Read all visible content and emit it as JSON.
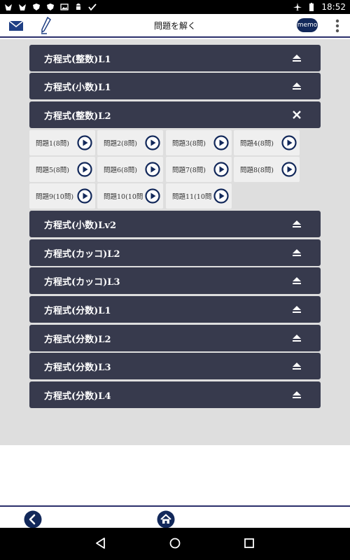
{
  "status_bar": {
    "time": "18:52",
    "left_icons": [
      "app-icon",
      "app-icon",
      "shield-icon",
      "shield-icon",
      "image-icon",
      "android-icon",
      "check-icon"
    ],
    "right_icons": [
      "airplane-icon",
      "battery-icon"
    ]
  },
  "app_bar": {
    "title": "問題を解く",
    "memo_label": "memo",
    "icons": [
      "mail-icon",
      "pen-icon",
      "overflow-menu-icon"
    ]
  },
  "sections_top": [
    {
      "label": "方程式(整数)L1",
      "state": "collapsed"
    },
    {
      "label": "方程式(小数)L1",
      "state": "collapsed"
    },
    {
      "label": "方程式(整数)L2",
      "state": "expanded"
    }
  ],
  "problems": [
    {
      "label": "問題1(8問)"
    },
    {
      "label": "問題2(8問)"
    },
    {
      "label": "問題3(8問)"
    },
    {
      "label": "問題4(8問)"
    },
    {
      "label": "問題5(8問)"
    },
    {
      "label": "問題6(8問)"
    },
    {
      "label": "問題7(8問)"
    },
    {
      "label": "問題8(8問)"
    },
    {
      "label": "問題9(10問)"
    },
    {
      "label": "問題10(10問"
    },
    {
      "label": "問題11(10問"
    }
  ],
  "sections_bottom": [
    {
      "label": "方程式(小数)Lv2",
      "state": "collapsed"
    },
    {
      "label": "方程式(カッコ)L2",
      "state": "collapsed"
    },
    {
      "label": "方程式(カッコ)L3",
      "state": "collapsed"
    },
    {
      "label": "方程式(分数)L1",
      "state": "collapsed"
    },
    {
      "label": "方程式(分数)L2",
      "state": "collapsed"
    },
    {
      "label": "方程式(分数)L3",
      "state": "collapsed"
    },
    {
      "label": "方程式(分数)L4",
      "state": "collapsed"
    }
  ],
  "bottom_bar": {
    "icons": [
      "back-icon",
      "home-icon"
    ]
  },
  "nav_bar": {
    "icons": [
      "nav-back-icon",
      "nav-home-icon",
      "nav-recents-icon"
    ]
  },
  "colors": {
    "bar_bg": "#373a4d",
    "accent_navy": "#12285a",
    "content_bg": "#dedede",
    "cell_bg": "#efefef"
  }
}
